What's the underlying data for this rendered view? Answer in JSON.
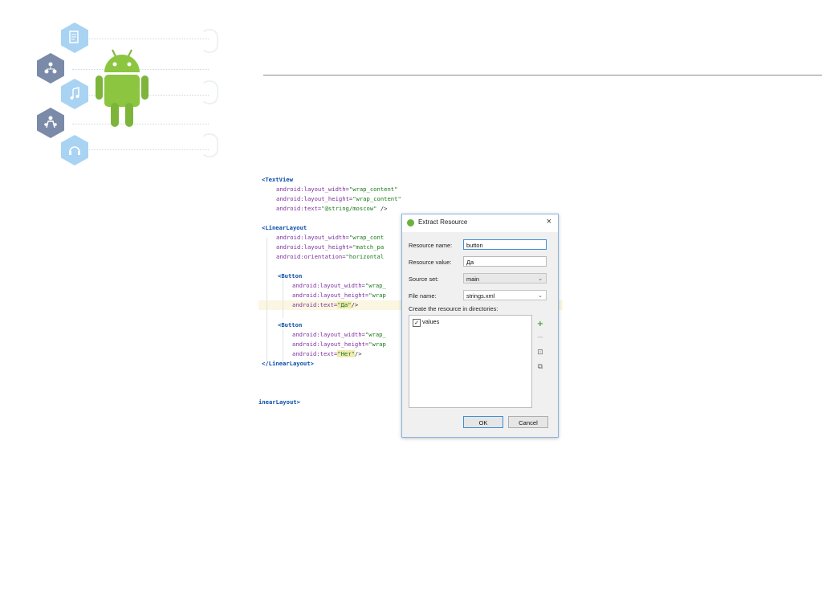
{
  "code_lines": [
    {
      "tag": "<TextView",
      "attr": "",
      "val": "",
      "rest": ""
    },
    {
      "tag": "",
      "attr": "android:layout_width=",
      "val": "\"wrap_content\"",
      "rest": ""
    },
    {
      "tag": "",
      "attr": "android:layout_height=",
      "val": "\"wrap_content\"",
      "rest": ""
    },
    {
      "tag": "",
      "attr": "android:text=",
      "val": "\"@string/moscow\"",
      "rest": " />"
    },
    {
      "tag": "<LinearLayout",
      "attr": "",
      "val": "",
      "rest": ""
    },
    {
      "tag": "",
      "attr": "android:layout_width=",
      "val": "\"wrap_cont",
      "rest": ""
    },
    {
      "tag": "",
      "attr": "android:layout_height=",
      "val": "\"match_pa",
      "rest": ""
    },
    {
      "tag": "",
      "attr": "android:orientation=",
      "val": "\"horizontal",
      "rest": ""
    },
    {
      "tag": "<Button",
      "attr": "",
      "val": "",
      "rest": ""
    },
    {
      "tag": "",
      "attr": "android:layout_width=",
      "val": "\"wrap_",
      "rest": ""
    },
    {
      "tag": "",
      "attr": "android:layout_height=",
      "val": "\"wrap",
      "rest": ""
    },
    {
      "tag": "",
      "attr": "android:text=",
      "val": "\"Да\"",
      "rest": "/>"
    },
    {
      "tag": "<Button",
      "attr": "",
      "val": "",
      "rest": ""
    },
    {
      "tag": "",
      "attr": "android:layout_width=",
      "val": "\"wrap_",
      "rest": ""
    },
    {
      "tag": "",
      "attr": "android:layout_height=",
      "val": "\"wrap",
      "rest": ""
    },
    {
      "tag": "",
      "attr": "android:text=",
      "val": "\"Нет\"",
      "rest": "/>"
    },
    {
      "tag": "</LinearLayout>",
      "attr": "",
      "val": "",
      "rest": ""
    },
    {
      "tag": "inearLayout>",
      "attr": "",
      "val": "",
      "rest": ""
    }
  ],
  "dialog": {
    "title": "Extract Resource",
    "close": "×",
    "resource_name_label": "Resource name:",
    "resource_name_value": "button",
    "resource_value_label": "Resource value:",
    "resource_value_value": "Да",
    "source_set_label": "Source set:",
    "source_set_value": "main",
    "file_name_label": "File name:",
    "file_name_value": "strings.xml",
    "directories_label": "Create the resource in directories:",
    "directory_item": "values",
    "directory_checked": true,
    "ok_label": "OK",
    "cancel_label": "Cancel",
    "icons": [
      "plus-icon",
      "minus-icon",
      "select-all-icon",
      "copy-icon"
    ]
  },
  "header_icons": [
    "document-icon",
    "people-icon",
    "music-icon",
    "family-icon",
    "headphones-icon",
    "android-mascot"
  ],
  "colors": {
    "hex_light": "#a9d3f2",
    "hex_dark": "#7a8aa8",
    "android_green": "#8cc53f",
    "dialog_border": "#8ab4dd",
    "add_green": "#3ea33e"
  }
}
